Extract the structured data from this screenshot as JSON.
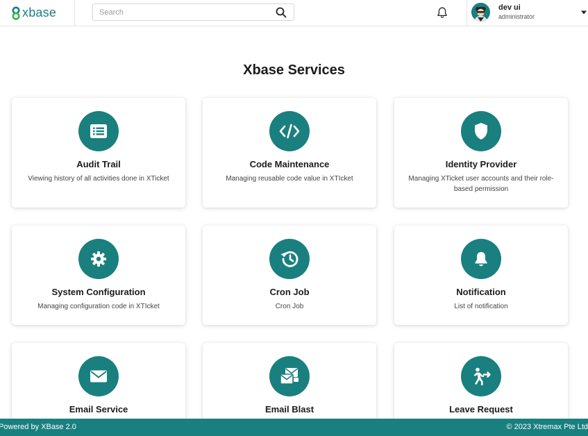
{
  "header": {
    "logo_text": "xbase",
    "search_placeholder": "Search",
    "user": {
      "name": "dev ui",
      "role": "administrator"
    }
  },
  "main": {
    "title": "Xbase Services",
    "services": [
      {
        "title": "Audit Trail",
        "description": "Viewing history of all activities done in XTicket",
        "icon": "list-icon"
      },
      {
        "title": "Code Maintenance",
        "description": "Managing reusable code value in XTIcket",
        "icon": "code-icon"
      },
      {
        "title": "Identity Provider",
        "description": "Managing XTicket user accounts and their role-based permission",
        "icon": "shield-icon"
      },
      {
        "title": "System Configuration",
        "description": "Managing configuration code in XTIcket",
        "icon": "gear-icon"
      },
      {
        "title": "Cron Job",
        "description": "Cron Job",
        "icon": "history-icon"
      },
      {
        "title": "Notification",
        "description": "List of notification",
        "icon": "bell-icon"
      },
      {
        "title": "Email Service",
        "description": "",
        "icon": "envelope-icon"
      },
      {
        "title": "Email Blast",
        "description": "",
        "icon": "email-blast-icon"
      },
      {
        "title": "Leave Request",
        "description": "",
        "icon": "leave-icon"
      }
    ]
  },
  "footer": {
    "left": "Powered by XBase 2.0",
    "right": "© 2023 Xtremax Pte Ltd"
  },
  "colors": {
    "accent": "#1a7f7f"
  }
}
